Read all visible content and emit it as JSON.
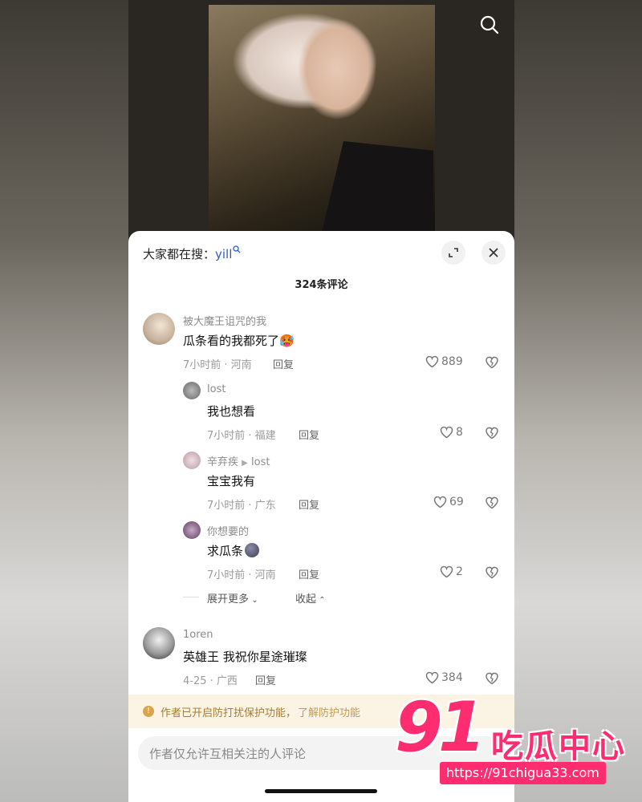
{
  "search_bar": {
    "prefix": "大家都在搜：",
    "keyword": "yill"
  },
  "comments_count": "324条评论",
  "comments": [
    {
      "user": "被大魔王诅咒的我",
      "text": "瓜条看的我都死了",
      "emoji": "🥵",
      "meta": "7小时前 · 河南",
      "reply": "回复",
      "likes": "889"
    },
    {
      "user": "lost",
      "text": "我也想看",
      "meta": "7小时前 · 福建",
      "reply": "回复",
      "likes": "8"
    },
    {
      "user": "辛弃疾",
      "reply_to": "lost",
      "text": "宝宝我有",
      "meta": "7小时前 · 广东",
      "reply": "回复",
      "likes": "69"
    },
    {
      "user": "你想要的",
      "text": "求瓜条",
      "meta": "7小时前 · 河南",
      "reply": "回复",
      "likes": "2"
    },
    {
      "user": "1oren",
      "text": "英雄王 我祝你星途璀璨",
      "meta": "4-25 · 广西",
      "reply": "回复",
      "likes": "384"
    }
  ],
  "expand": {
    "more": "展开更多",
    "collapse": "收起"
  },
  "banner": {
    "text": "作者已开启防打扰保护功能，",
    "link": "了解防护功能"
  },
  "input": {
    "placeholder": "作者仅允许互相关注的人评论"
  },
  "watermark": {
    "number": "91",
    "title": "吃瓜中心",
    "url": "https://91chigua33.com"
  },
  "colors": {
    "accent": "#ff2d6f",
    "keyword": "#2a5bd7",
    "banner_bg": "#fbf4e4"
  }
}
